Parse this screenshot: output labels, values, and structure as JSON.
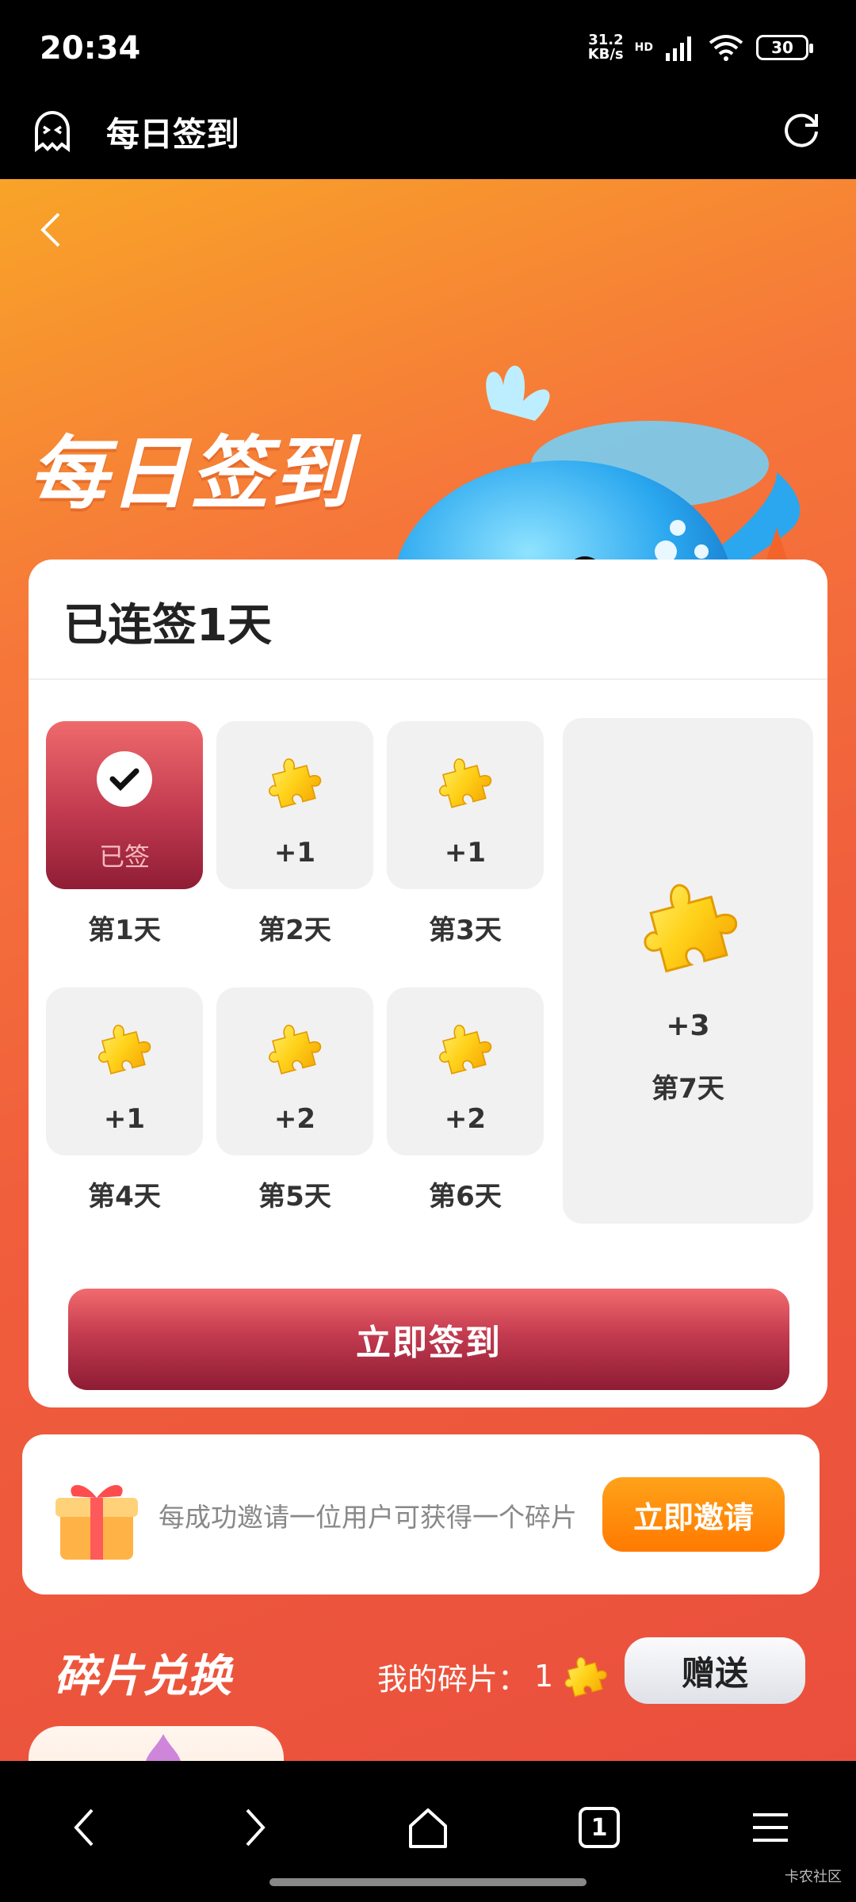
{
  "status_bar": {
    "time": "20:34",
    "net_speed_value": "31.2",
    "net_speed_unit": "KB/s",
    "network": "HD",
    "battery": "30"
  },
  "app_bar": {
    "title": "每日签到"
  },
  "hero": {
    "title": "每日签到"
  },
  "sign_card": {
    "streak_title": "已连签1天",
    "days": [
      {
        "label": "第1天",
        "value": "已签",
        "signed": true
      },
      {
        "label": "第2天",
        "value": "+1",
        "signed": false
      },
      {
        "label": "第3天",
        "value": "+1",
        "signed": false
      },
      {
        "label": "第4天",
        "value": "+1",
        "signed": false
      },
      {
        "label": "第5天",
        "value": "+2",
        "signed": false
      },
      {
        "label": "第6天",
        "value": "+2",
        "signed": false
      },
      {
        "label": "第7天",
        "value": "+3",
        "signed": false
      }
    ],
    "sign_button_label": "立即签到"
  },
  "invite": {
    "text": "每成功邀请一位用户可获得一个碎片",
    "button_label": "立即邀请"
  },
  "exchange": {
    "title": "碎片兑换",
    "my_fragments_label": "我的碎片：",
    "my_fragments_count": "1",
    "send_button_label": "赠送"
  },
  "bottom_nav": {
    "tab_count": "1"
  },
  "watermark": "卡农社区",
  "colors": {
    "accent_gradient_top": "#f8a428",
    "accent_gradient_bottom": "#ea4f3d",
    "signed_tile": "#c13a4f",
    "invite_button": "#ff7a00",
    "puzzle": "#ffd21a"
  }
}
